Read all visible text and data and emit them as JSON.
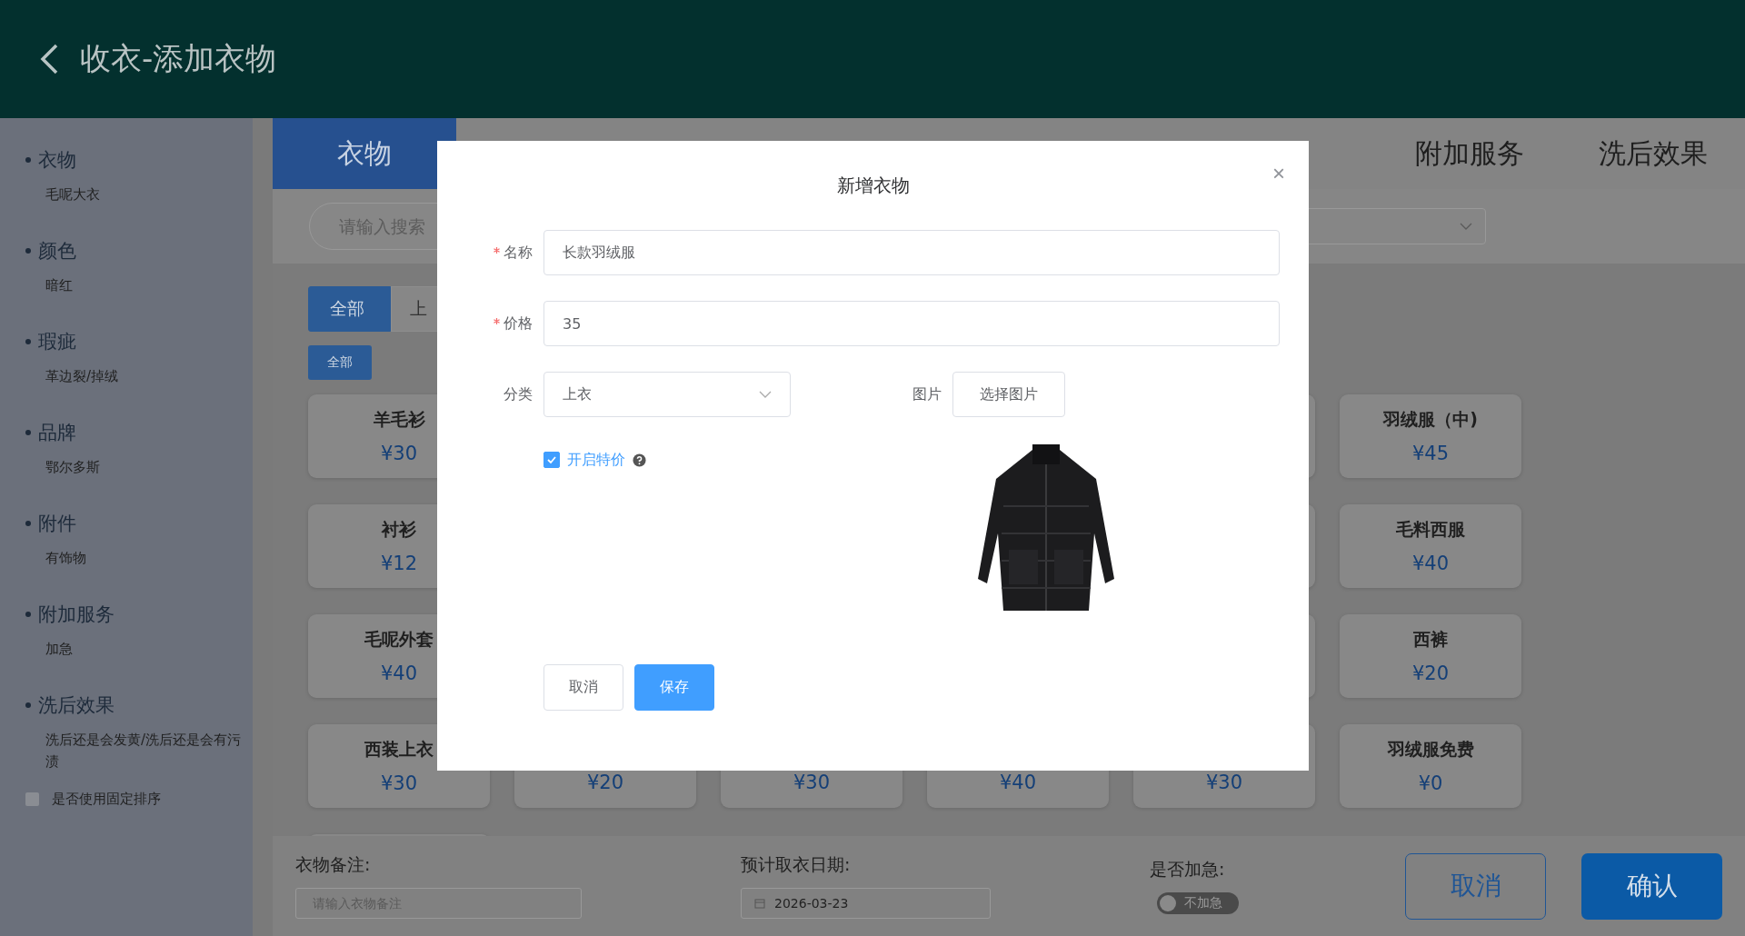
{
  "header": {
    "title": "收衣-添加衣物"
  },
  "sidebar": {
    "items": [
      {
        "title": "衣物",
        "value": "毛呢大衣"
      },
      {
        "title": "颜色",
        "value": "暗红"
      },
      {
        "title": "瑕疵",
        "value": "革边裂/掉绒"
      },
      {
        "title": "品牌",
        "value": "鄂尔多斯"
      },
      {
        "title": "附件",
        "value": "有饰物"
      },
      {
        "title": "附加服务",
        "value": "加急"
      },
      {
        "title": "洗后效果",
        "value": "洗后还是会发黄/洗后还是会有污渍"
      }
    ],
    "fixed_order": {
      "label": "是否使用固定排序",
      "checked": false
    }
  },
  "tabs": [
    {
      "label": "衣物",
      "selected": true
    },
    {
      "label": "附加服务",
      "selected": false
    },
    {
      "label": "洗后效果",
      "selected": false
    }
  ],
  "search": {
    "placeholder": "请输入搜索"
  },
  "category_filters": [
    {
      "label": "全部",
      "selected": true
    },
    {
      "label": "上",
      "selected": false
    }
  ],
  "sub_filters": [
    {
      "label": "全部",
      "selected": true
    }
  ],
  "card_rows": [
    [
      {
        "kind": "item",
        "name": "羊毛衫",
        "price": "¥30"
      },
      {
        "kind": "covered"
      },
      {
        "kind": "item",
        "name": "羽绒服（中)",
        "price": "¥45"
      }
    ],
    [
      {
        "kind": "item",
        "name": "衬衫",
        "price": "¥12"
      },
      {
        "kind": "covered"
      },
      {
        "kind": "item",
        "name": "毛料西服",
        "price": "¥40"
      }
    ],
    [
      {
        "kind": "item",
        "name": "毛呢外套",
        "price": "¥40"
      },
      {
        "kind": "covered"
      },
      {
        "kind": "item",
        "name": "西裤",
        "price": "¥20"
      }
    ],
    [
      {
        "kind": "item",
        "name": "西装上衣",
        "price": "¥30"
      },
      {
        "kind": "item",
        "price": "¥20"
      },
      {
        "kind": "item",
        "price": "¥30"
      },
      {
        "kind": "item",
        "price": "¥40"
      },
      {
        "kind": "item",
        "price": "¥30"
      },
      {
        "kind": "item",
        "name": "羽绒服免费",
        "price": "¥0"
      }
    ],
    [
      {
        "kind": "covered"
      }
    ]
  ],
  "footer": {
    "note_label": "衣物备注:",
    "note_placeholder": "请输入衣物备注",
    "date_label": "预计取衣日期:",
    "date_value": "2026-03-23",
    "urgent_label": "是否加急:",
    "urgent": {
      "label": "不加急",
      "on": false
    },
    "cancel": "取消",
    "confirm": "确认"
  },
  "dialog": {
    "title": "新增衣物",
    "close": "×",
    "name": {
      "label": "名称",
      "required": true,
      "value": "长款羽绒服"
    },
    "price": {
      "label": "价格",
      "required": true,
      "value": "35"
    },
    "category": {
      "label": "分类",
      "value": "上衣"
    },
    "image": {
      "label": "图片",
      "button": "选择图片",
      "kind": "picture"
    },
    "special_price": {
      "label": "开启特价",
      "checked": true
    },
    "cancel": "取消",
    "save": "保存"
  }
}
